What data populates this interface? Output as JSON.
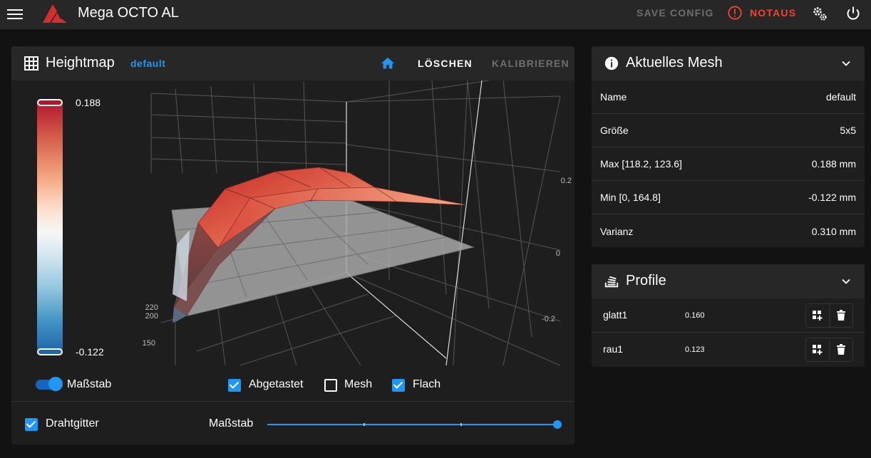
{
  "appbar": {
    "title": "Mega OCTO AL",
    "save_config": "SAVE CONFIG",
    "notaus": "NOTAUS",
    "icons": [
      "menu-icon",
      "logo-icon",
      "alert-icon",
      "cogs-icon",
      "power-icon"
    ]
  },
  "heightmap": {
    "title": "Heightmap",
    "profile": "default",
    "clear_label": "LÖSCHEN",
    "calibrate_label": "KALIBRIEREN",
    "legend_max": "0.188",
    "legend_min": "-0.122",
    "axis_ticks": {
      "z": [
        "0.2",
        "0",
        "-0.2"
      ],
      "y": [
        "220",
        "200",
        "150"
      ]
    },
    "scale_toggle_label": "Maßstab",
    "scale_toggle_on": true,
    "checkboxes": [
      {
        "label": "Abgetastet",
        "checked": true
      },
      {
        "label": "Mesh",
        "checked": false
      },
      {
        "label": "Flach",
        "checked": true
      }
    ],
    "wireframe_label": "Drahtgitter",
    "wireframe_checked": true,
    "scale_slider_label": "Maßstab",
    "scale_slider_value": 1.0
  },
  "mesh": {
    "title": "Aktuelles Mesh",
    "rows": [
      {
        "key": "Name",
        "value": "default"
      },
      {
        "key": "Größe",
        "value": "5x5"
      },
      {
        "key": "Max [118.2, 123.6]",
        "value": "0.188 mm"
      },
      {
        "key": "Min [0, 164.8]",
        "value": "-0.122 mm"
      },
      {
        "key": "Varianz",
        "value": "0.310 mm"
      }
    ]
  },
  "profiles": {
    "title": "Profile",
    "items": [
      {
        "name": "glatt1",
        "value": "0.160"
      },
      {
        "name": "rau1",
        "value": "0.123"
      }
    ]
  },
  "colors": {
    "accent": "#2196f3",
    "danger": "#f44336",
    "surface": "#1e1e1e",
    "header": "#272727",
    "background": "#121212"
  }
}
